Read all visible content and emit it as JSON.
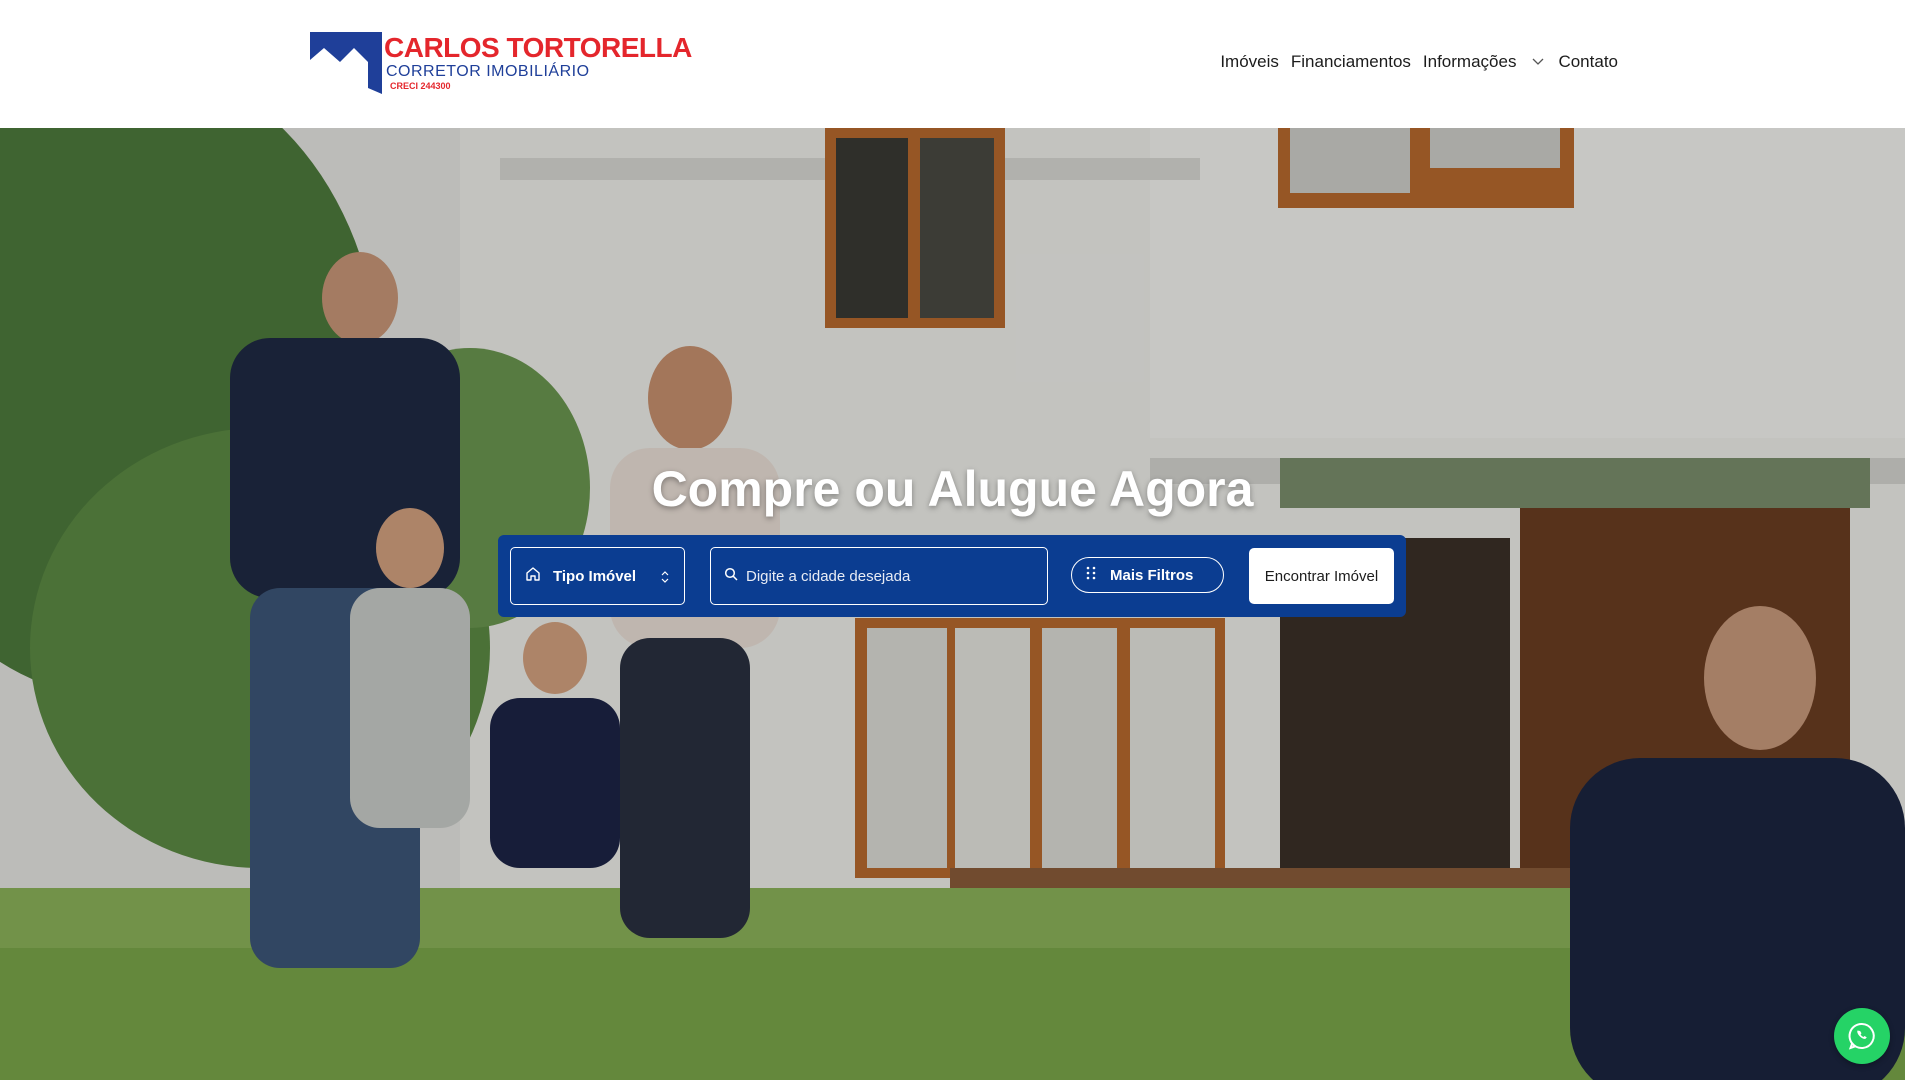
{
  "brand": {
    "name": "CARLOS TORTORELLA",
    "subtitle": "CORRETOR IMOBILIÁRIO",
    "creci": "CRECI 244300"
  },
  "nav": {
    "items": [
      {
        "label": "Imóveis"
      },
      {
        "label": "Financiamentos"
      },
      {
        "label": "Informações"
      },
      {
        "label": "Contato"
      }
    ]
  },
  "hero": {
    "title": "Compre ou Alugue Agora"
  },
  "search": {
    "type_label": "Tipo Imóvel",
    "city_placeholder": "Digite a cidade desejada",
    "filters_label": "Mais Filtros",
    "submit_label": "Encontrar Imóvel"
  },
  "colors": {
    "brand_red": "#e4262c",
    "brand_blue": "#1f3f99",
    "search_bar": "#0b3d91",
    "whatsapp": "#25d366"
  },
  "icons": {
    "type": "home-icon",
    "city": "search-icon",
    "filters": "grid-dots-icon",
    "float": "whatsapp-icon"
  }
}
